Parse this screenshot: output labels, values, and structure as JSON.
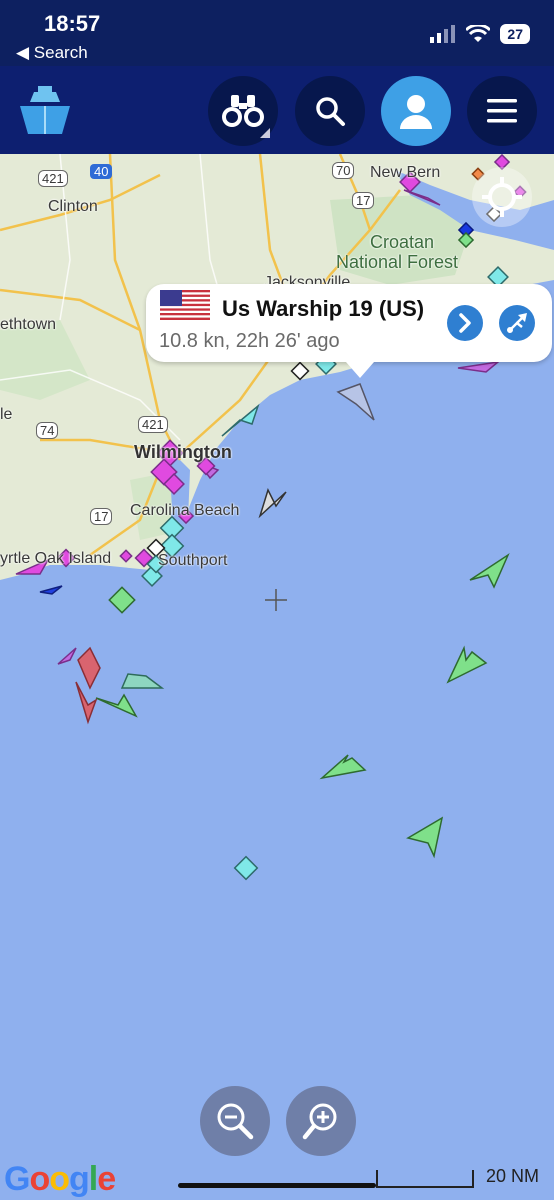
{
  "status_bar": {
    "time": "18:57",
    "back_label": "◀ Search",
    "battery": "27"
  },
  "header": {
    "buttons": [
      {
        "name": "binoculars",
        "icon": "binoculars-icon"
      },
      {
        "name": "search",
        "icon": "search-icon"
      },
      {
        "name": "profile",
        "icon": "user-icon"
      },
      {
        "name": "menu",
        "icon": "menu-icon"
      }
    ]
  },
  "map": {
    "labels": {
      "clinton": "Clinton",
      "new_bern": "New Bern",
      "croatan": "Croatan",
      "national_forest": "National Forest",
      "jacksonville": "Jacksonville",
      "elizabethtown": "ethtown",
      "le": "le",
      "wilmington": "Wilmington",
      "carolina_beach": "Carolina Beach",
      "oak_island": "yrtle Oak Island",
      "southport": "Southport"
    },
    "road_shields": [
      "421",
      "40",
      "70",
      "17",
      "421",
      "74",
      "17"
    ]
  },
  "callout": {
    "flag": "us-flag",
    "vessel_name": "Us Warship 19 (US)",
    "info": "10.8 kn, 22h 26' ago"
  },
  "footer": {
    "google": "Google",
    "scale": "20 NM"
  },
  "colors": {
    "header_bg": "#0d1f70",
    "button_bg": "#07174d",
    "active_button": "#3ea0e6",
    "sea": "#8fb0ee",
    "land": "#e6ecd8"
  }
}
